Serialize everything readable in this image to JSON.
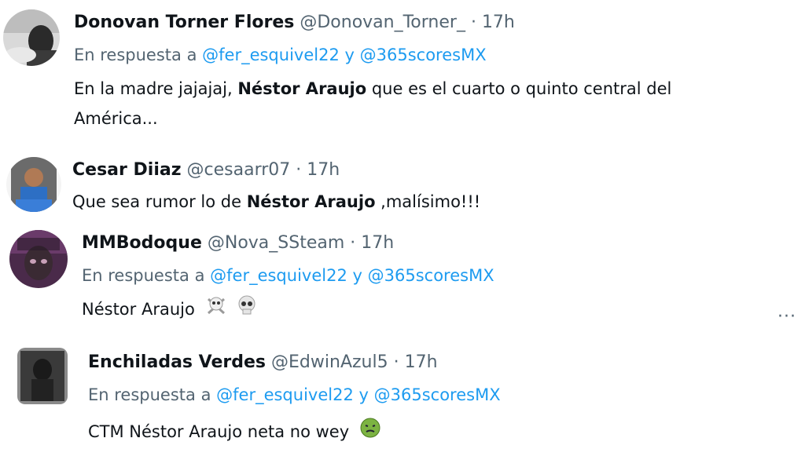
{
  "tweets": [
    {
      "name": "Donovan Torner Flores",
      "handle": "@Donovan_Torner_",
      "time": "· 17h",
      "reply_prefix": "En respuesta a",
      "mention1": "@fer_esquivel22",
      "reply_and": "y",
      "mention2": "@365scoresMX",
      "text_before": "En la madre jajajaj, ",
      "text_bold": "Néstor Araujo",
      "text_after": " que es el cuarto o quinto central del",
      "text_line2": "América..."
    },
    {
      "name": "Cesar Diiaz",
      "handle": "@cesaarr07",
      "time": "· 17h",
      "more_icon": "more-horizontal-icon",
      "text_before": "Que sea rumor lo de ",
      "text_bold": "Néstor Araujo",
      "text_after": " ,malísimo!!!"
    },
    {
      "name": "MMBodoque",
      "handle": "@Nova_SSteam",
      "time": "· 17h",
      "reply_prefix": "En respuesta a",
      "mention1": "@fer_esquivel22",
      "reply_and": "y",
      "mention2": "@365scoresMX",
      "text": "Néstor Araujo",
      "emojis": [
        "skull-and-crossbones-icon",
        "skull-icon"
      ]
    },
    {
      "name": "Enchiladas Verdes",
      "handle": "@EdwinAzul5",
      "time": "· 17h",
      "reply_prefix": "En respuesta a",
      "mention1": "@fer_esquivel22",
      "reply_and": "y",
      "mention2": "@365scoresMX",
      "text": "CTM Néstor Araujo neta no wey",
      "emojis": [
        "nauseated-face-icon"
      ]
    }
  ],
  "colors": {
    "mention": "#1d9bf0",
    "secondary": "#536471",
    "primary": "#0f1419"
  }
}
